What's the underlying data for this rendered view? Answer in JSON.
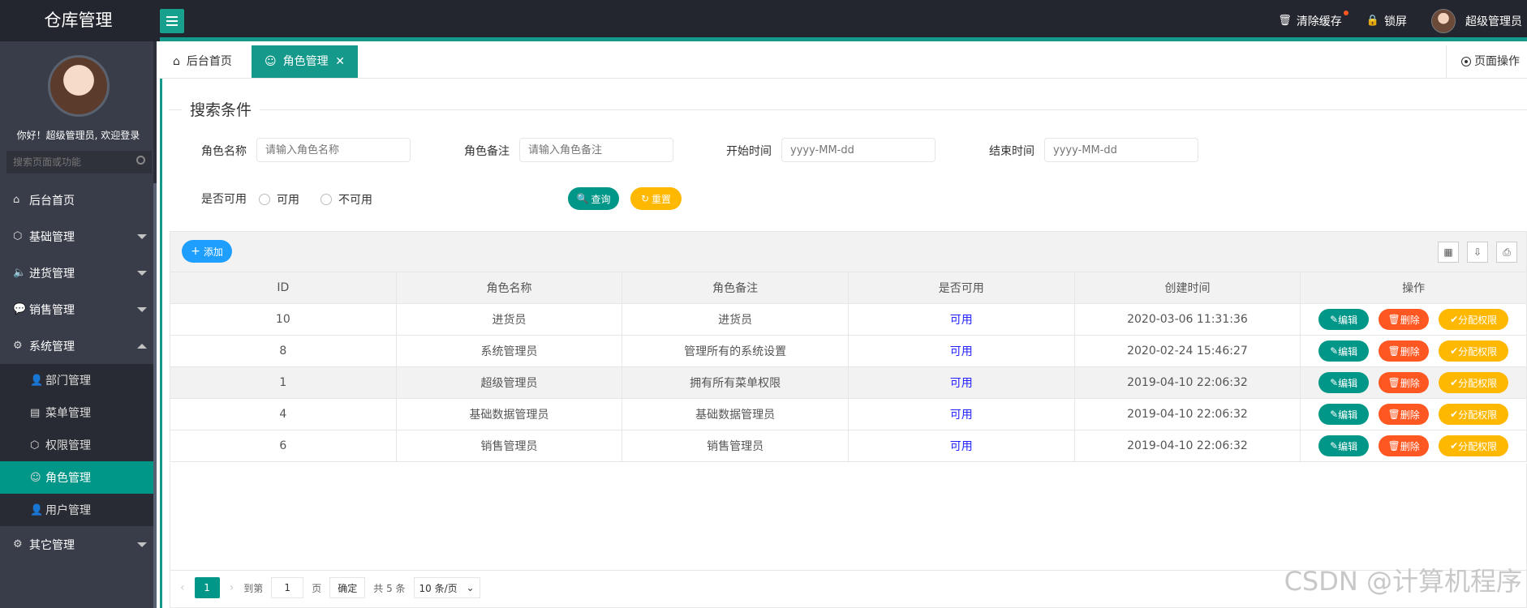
{
  "app": {
    "title": "仓库管理",
    "header": {
      "clear_cache": "清除缓存",
      "lock_screen": "锁屏",
      "user_name": "超级管理员"
    }
  },
  "sidebar": {
    "welcome": "你好！超级管理员, 欢迎登录",
    "search_placeholder": "搜索页面或功能",
    "items": [
      {
        "label": "后台首页"
      },
      {
        "label": "基础管理"
      },
      {
        "label": "进货管理"
      },
      {
        "label": "销售管理"
      },
      {
        "label": "系统管理"
      },
      {
        "label": "其它管理"
      }
    ],
    "system_sub": [
      {
        "label": "部门管理"
      },
      {
        "label": "菜单管理"
      },
      {
        "label": "权限管理"
      },
      {
        "label": "角色管理"
      },
      {
        "label": "用户管理"
      }
    ]
  },
  "tabs": {
    "home": "后台首页",
    "active": "角色管理",
    "close_glyph": "✕",
    "page_ops": "页面操作"
  },
  "search": {
    "legend": "搜索条件",
    "role_name_label": "角色名称",
    "role_name_placeholder": "请输入角色名称",
    "role_remark_label": "角色备注",
    "role_remark_placeholder": "请输入角色备注",
    "start_time_label": "开始时间",
    "start_time_placeholder": "yyyy-MM-dd",
    "end_time_label": "结束时间",
    "end_time_placeholder": "yyyy-MM-dd",
    "available_label": "是否可用",
    "opt_available": "可用",
    "opt_unavailable": "不可用",
    "query_btn": "查询",
    "reset_btn": "重置"
  },
  "table": {
    "add_btn": "添加",
    "columns": [
      "ID",
      "角色名称",
      "角色备注",
      "是否可用",
      "创建时间",
      "操作"
    ],
    "rows": [
      {
        "id": "10",
        "name": "进货员",
        "remark": "进货员",
        "available": "可用",
        "created": "2020-03-06 11:31:36"
      },
      {
        "id": "8",
        "name": "系统管理员",
        "remark": "管理所有的系统设置",
        "available": "可用",
        "created": "2020-02-24 15:46:27"
      },
      {
        "id": "1",
        "name": "超级管理员",
        "remark": "拥有所有菜单权限",
        "available": "可用",
        "created": "2019-04-10 22:06:32"
      },
      {
        "id": "4",
        "name": "基础数据管理员",
        "remark": "基础数据管理员",
        "available": "可用",
        "created": "2019-04-10 22:06:32"
      },
      {
        "id": "6",
        "name": "销售管理员",
        "remark": "销售管理员",
        "available": "可用",
        "created": "2019-04-10 22:06:32"
      }
    ],
    "ops": {
      "edit": "编辑",
      "delete": "删除",
      "assign": "分配权限"
    }
  },
  "pager": {
    "current": "1",
    "goto_label": "到第",
    "goto_value": "1",
    "page_unit": "页",
    "confirm": "确定",
    "total": "共 5 条",
    "page_size": "10 条/页"
  },
  "watermark": "CSDN @计算机程序",
  "colors": {
    "header_bg": "#23262e",
    "sidebar_bg": "#393d49",
    "accent": "#009688",
    "danger": "#ff5722",
    "warn": "#ffb800",
    "primary": "#1e9fff"
  }
}
